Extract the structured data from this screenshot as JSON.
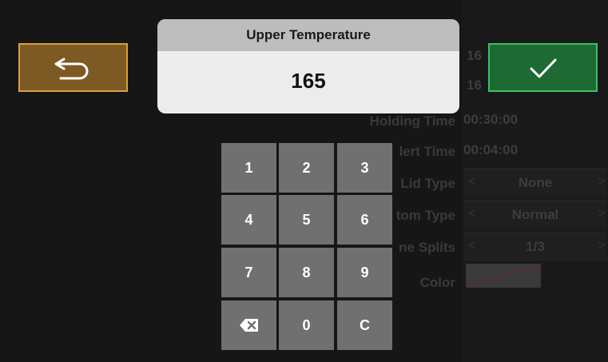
{
  "dialog": {
    "title": "Upper Temperature",
    "value": "165"
  },
  "buttons": {
    "back_icon": "undo-arrow-icon",
    "confirm_icon": "checkmark-icon",
    "back_color": "#7d5a23",
    "confirm_color": "#1e6a34"
  },
  "keypad": {
    "k1": "1",
    "k2": "2",
    "k3": "3",
    "k4": "4",
    "k5": "5",
    "k6": "6",
    "k7": "7",
    "k8": "8",
    "k9": "9",
    "backspace_icon": "backspace-icon",
    "k0": "0",
    "clear": "C"
  },
  "background": {
    "top_values": [
      "16",
      "16"
    ],
    "holding_time_label": "Holding Time",
    "holding_time_value": "00:30:00",
    "alert_time_label": "lert Time",
    "alert_time_value": "00:04:00",
    "lid_type_label": "Lid Type",
    "lid_type_value": "None",
    "bottom_type_label": "tom Type",
    "bottom_type_value": "Normal",
    "splits_label": "ne Splits",
    "splits_value": "1/3",
    "color_label": "Color"
  }
}
